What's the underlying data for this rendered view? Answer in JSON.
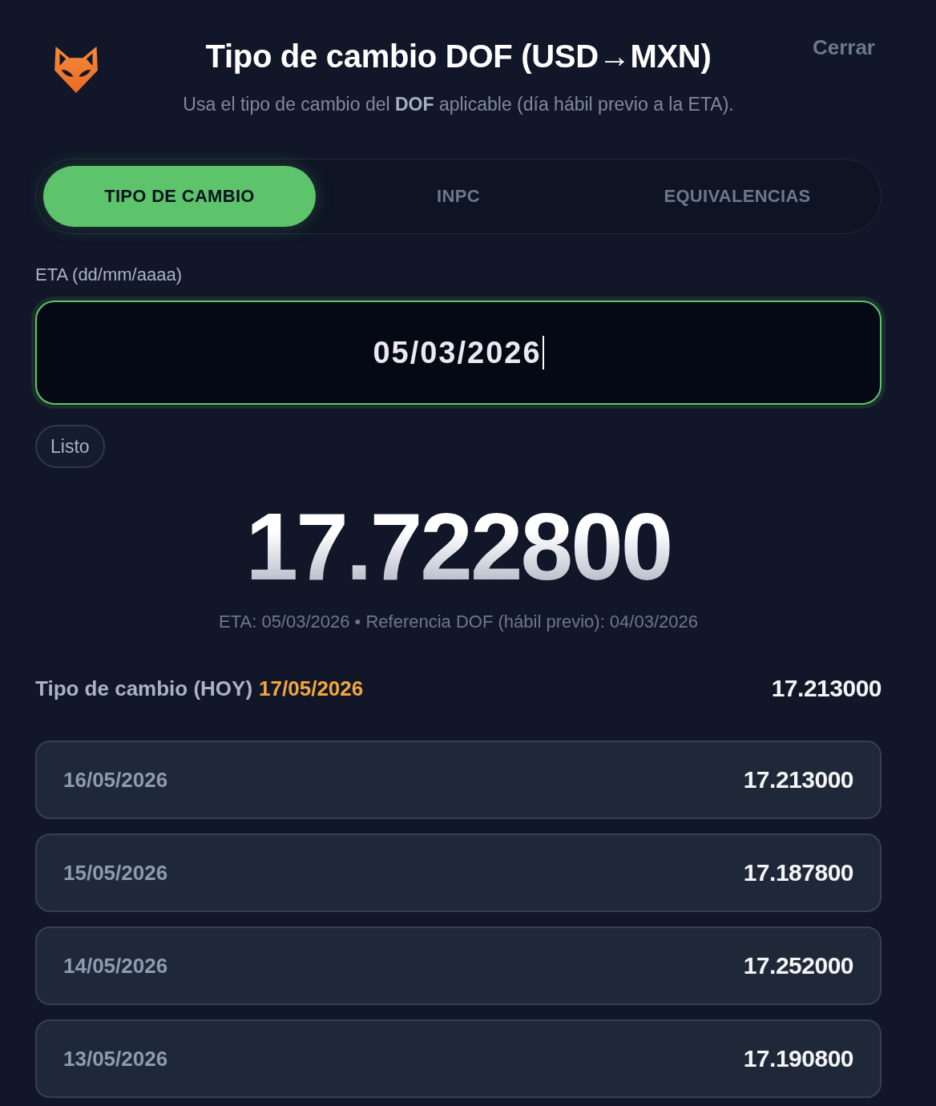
{
  "header": {
    "title": "Tipo de cambio DOF (USD→MXN)",
    "subtitle": "Usa el tipo de cambio del **DOF** aplicable (día hábil previo a la ETA).",
    "close_label": "Cerrar"
  },
  "tabs": [
    {
      "label": "TIPO DE CAMBIO",
      "selected": true
    },
    {
      "label": "INPC",
      "selected": false
    },
    {
      "label": "EQUIVALENCIAS",
      "selected": false
    }
  ],
  "eta_field": {
    "label": "ETA (dd/mm/aaaa)",
    "value": "05/03/2026",
    "focused": true
  },
  "done_button": "Listo",
  "result": {
    "rate": "17.722800",
    "note": "ETA: 05/03/2026 • Referencia DOF (hábil previo): 04/03/2026"
  },
  "today": {
    "label": "Tipo de cambio (HOY)",
    "date": "17/05/2026",
    "rate": "17.213000"
  },
  "history": [
    {
      "date": "16/05/2026",
      "rate": "17.213000"
    },
    {
      "date": "15/05/2026",
      "rate": "17.187800"
    },
    {
      "date": "14/05/2026",
      "rate": "17.252000"
    },
    {
      "date": "13/05/2026",
      "rate": "17.190800"
    }
  ]
}
